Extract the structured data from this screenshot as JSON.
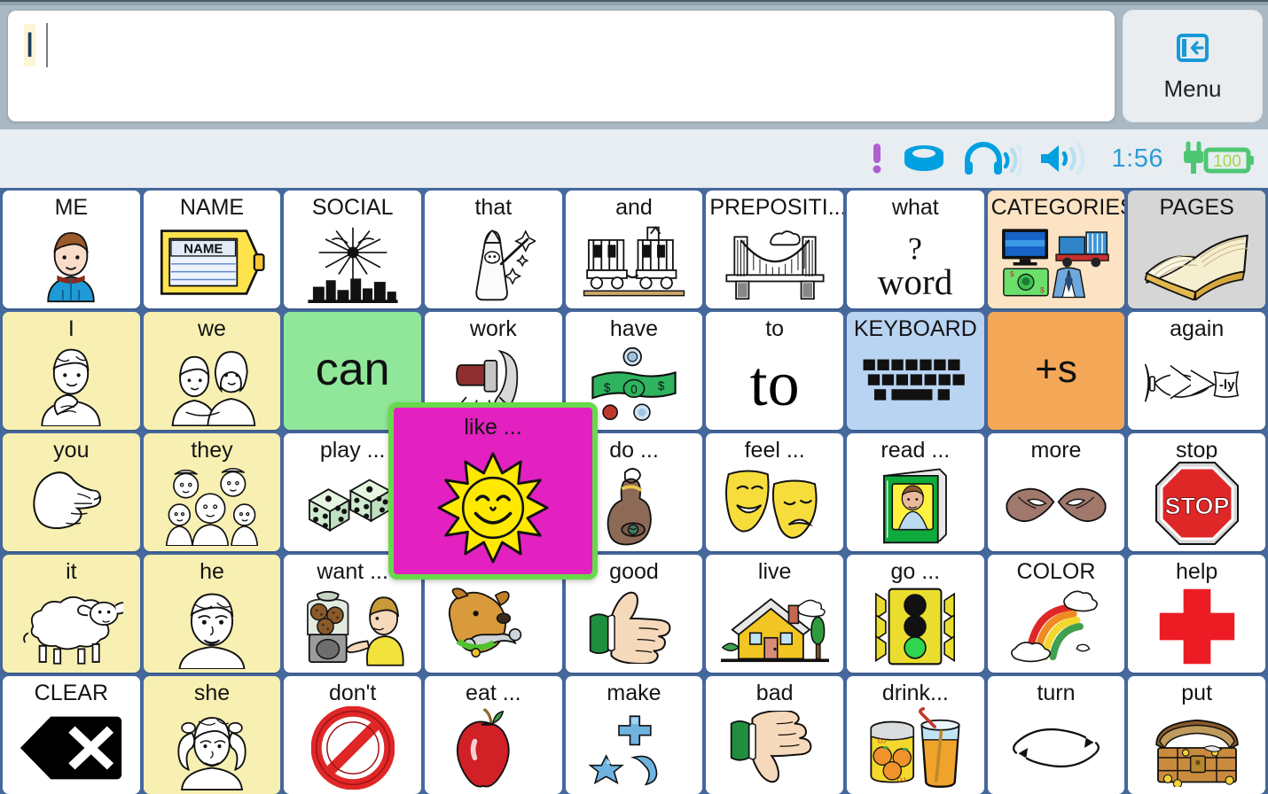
{
  "message_bar": {
    "text": "I",
    "placeholder": "",
    "caret": true
  },
  "menu": {
    "label": "Menu",
    "icon": "panel-collapse-icon"
  },
  "status": {
    "time": "1:56",
    "battery_level": "100",
    "icons": [
      "alert-icon",
      "speaker-puck-icon",
      "headphones-icon",
      "volume-icon",
      "battery-charging-icon"
    ],
    "colors": {
      "accent_blue": "#00a0e0",
      "alert_purple": "#b05fd0",
      "battery_green": "#4ec772",
      "time_blue": "#2c9bd6"
    }
  },
  "board": {
    "columns": 9,
    "rows": 5,
    "grid_color": "#45689d",
    "cells": [
      {
        "label": "ME",
        "color": "c-white",
        "art": "boy-blue-shirt"
      },
      {
        "label": "NAME",
        "color": "c-white",
        "art": "name-tag"
      },
      {
        "label": "SOCIAL",
        "color": "c-white",
        "art": "fireworks"
      },
      {
        "label": "that",
        "color": "c-white",
        "art": "wizard-wand"
      },
      {
        "label": "and",
        "color": "c-white",
        "art": "train-cars"
      },
      {
        "label": "PREPOSITI...",
        "color": "c-white",
        "art": "bridge"
      },
      {
        "label": "what",
        "color": "c-white",
        "art": "question-word"
      },
      {
        "label": "CATEGORIES",
        "color": "c-peach",
        "art": "tv-truck-money-suit"
      },
      {
        "label": "PAGES",
        "color": "c-grey",
        "art": "open-book"
      },
      {
        "label": "I",
        "color": "c-yellow",
        "art": "child-self-point"
      },
      {
        "label": "we",
        "color": "c-yellow",
        "art": "two-girls"
      },
      {
        "label": "can",
        "color": "c-green",
        "art": "text-can"
      },
      {
        "label": "work",
        "color": "c-white",
        "art": "hammer-nail"
      },
      {
        "label": "have",
        "color": "c-white",
        "art": "money-coins"
      },
      {
        "label": "to",
        "color": "c-white",
        "art": "text-to"
      },
      {
        "label": "KEYBOARD",
        "color": "c-blue",
        "art": "keyboard"
      },
      {
        "label": "+s",
        "color": "c-orange",
        "art": "text-plus-s"
      },
      {
        "label": "again",
        "color": "c-white",
        "art": "plane-ly-banner"
      },
      {
        "label": "you",
        "color": "c-yellow",
        "art": "pointing-hand"
      },
      {
        "label": "they",
        "color": "c-yellow",
        "art": "group-people"
      },
      {
        "label": "play ...",
        "color": "c-white",
        "art": "dice"
      },
      {
        "label": "like ...",
        "color": "c-white",
        "art": "smiling-sun"
      },
      {
        "label": "do ...",
        "color": "c-white",
        "art": "finger-string"
      },
      {
        "label": "feel ...",
        "color": "c-white",
        "art": "drama-masks"
      },
      {
        "label": "read ...",
        "color": "c-white",
        "art": "green-book"
      },
      {
        "label": "more",
        "color": "c-white",
        "art": "hands-more-sign"
      },
      {
        "label": "stop",
        "color": "c-white",
        "art": "stop-sign"
      },
      {
        "label": "it",
        "color": "c-yellow",
        "art": "sheep"
      },
      {
        "label": "he",
        "color": "c-yellow",
        "art": "boy-face"
      },
      {
        "label": "want ...",
        "color": "c-white",
        "art": "cookie-jar-child"
      },
      {
        "label": " ",
        "color": "c-white",
        "art": "dog-bone"
      },
      {
        "label": "good",
        "color": "c-white",
        "art": "thumbs-up"
      },
      {
        "label": "live",
        "color": "c-white",
        "art": "yellow-house"
      },
      {
        "label": "go ...",
        "color": "c-white",
        "art": "traffic-light"
      },
      {
        "label": "COLOR",
        "color": "c-white",
        "art": "rainbow"
      },
      {
        "label": "help",
        "color": "c-white",
        "art": "red-cross"
      },
      {
        "label": "CLEAR",
        "color": "c-white",
        "art": "backspace-x"
      },
      {
        "label": "she",
        "color": "c-yellow",
        "art": "girl-pigtails"
      },
      {
        "label": "don't",
        "color": "c-white",
        "art": "prohibited-sign"
      },
      {
        "label": "eat ...",
        "color": "c-white",
        "art": "red-apple"
      },
      {
        "label": "make",
        "color": "c-white",
        "art": "blue-shapes"
      },
      {
        "label": "bad",
        "color": "c-white",
        "art": "thumbs-down"
      },
      {
        "label": "drink...",
        "color": "c-white",
        "art": "juice-can-glass"
      },
      {
        "label": "turn",
        "color": "c-white",
        "art": "rotate-arrows"
      },
      {
        "label": "put",
        "color": "c-white",
        "art": "treasure-chest"
      }
    ]
  },
  "popup": {
    "label": "like ...",
    "art": "smiling-sun",
    "background": "#e320c0",
    "border": "#67d94a"
  }
}
